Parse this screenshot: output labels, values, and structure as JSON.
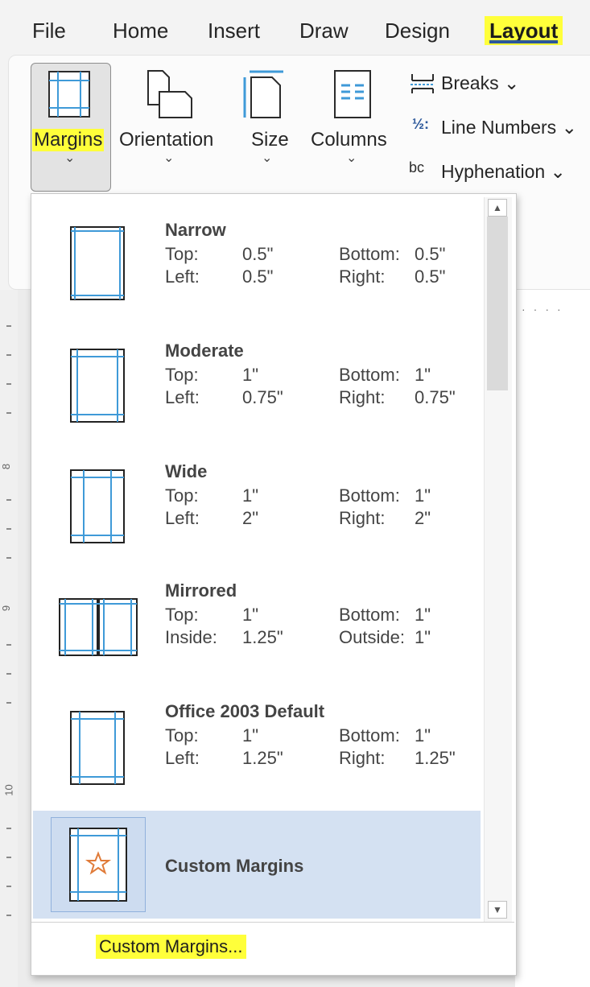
{
  "menu": {
    "tabs": [
      "File",
      "Home",
      "Insert",
      "Draw",
      "Design",
      "Layout"
    ]
  },
  "ribbon": {
    "margins_label": "Margins",
    "orientation_label": "Orientation",
    "size_label": "Size",
    "columns_label": "Columns",
    "breaks_label": "Breaks",
    "line_numbers_label": "Line Numbers",
    "hyphenation_label": "Hyphenation",
    "chevron": "⌄",
    "small_chevron": "⌄"
  },
  "ruler": {
    "numbers": [
      "8",
      "9",
      "10"
    ]
  },
  "dropdown": {
    "presets": [
      {
        "name": "Narrow",
        "k1": "Top:",
        "v1": "0.5\"",
        "k2": "Bottom:",
        "v2": "0.5\"",
        "k3": "Left:",
        "v3": "0.5\"",
        "k4": "Right:",
        "v4": "0.5\""
      },
      {
        "name": "Moderate",
        "k1": "Top:",
        "v1": "1\"",
        "k2": "Bottom:",
        "v2": "1\"",
        "k3": "Left:",
        "v3": "0.75\"",
        "k4": "Right:",
        "v4": "0.75\""
      },
      {
        "name": "Wide",
        "k1": "Top:",
        "v1": "1\"",
        "k2": "Bottom:",
        "v2": "1\"",
        "k3": "Left:",
        "v3": "2\"",
        "k4": "Right:",
        "v4": "2\""
      },
      {
        "name": "Mirrored",
        "k1": "Top:",
        "v1": "1\"",
        "k2": "Bottom:",
        "v2": "1\"",
        "k3": "Inside:",
        "v3": "1.25\"",
        "k4": "Outside:",
        "v4": "1\""
      },
      {
        "name": "Office 2003 Default",
        "k1": "Top:",
        "v1": "1\"",
        "k2": "Bottom:",
        "v2": "1\"",
        "k3": "Left:",
        "v3": "1.25\"",
        "k4": "Right:",
        "v4": "1.25\""
      }
    ],
    "custom_name": "Custom Margins",
    "footer_link": "Custom Margins...",
    "scroll_up": "▲",
    "scroll_down": "▼"
  },
  "colors": {
    "highlight": "#ffff3a",
    "accent": "#2b579a",
    "margin_line": "#3f9ad8",
    "selected_row": "#d4e1f2"
  }
}
